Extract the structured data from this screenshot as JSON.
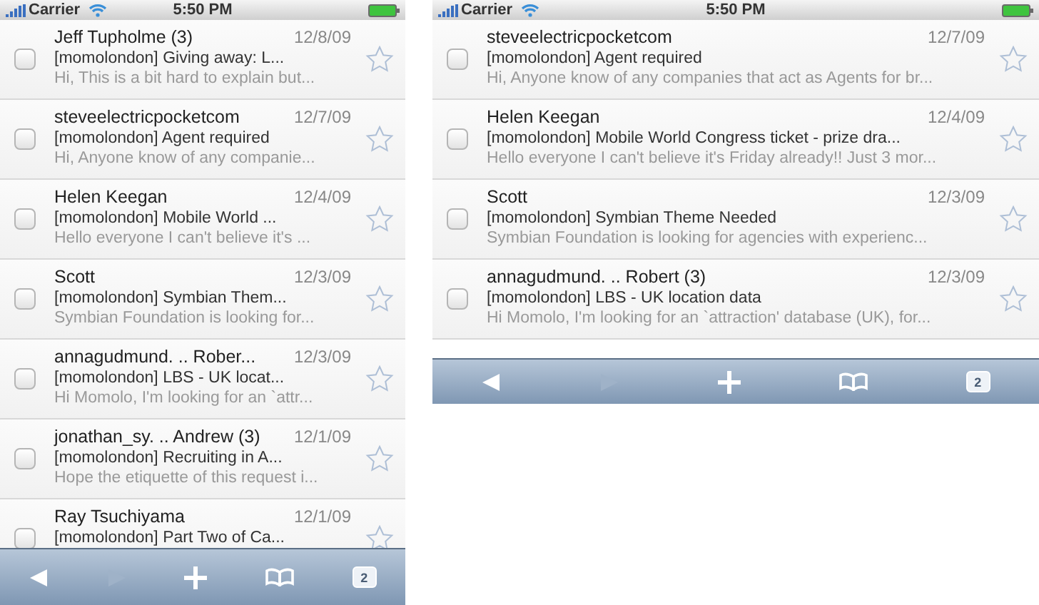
{
  "phones": [
    {
      "status": {
        "carrier": "Carrier",
        "time": "5:50 PM"
      },
      "kind": "portrait",
      "rows": [
        {
          "sender": "Jeff Tupholme (3)",
          "date": "12/8/09",
          "subject": "[momolondon] Giving away: L...",
          "snippet": "Hi, This is a bit hard to explain but...",
          "checked": false,
          "starred": false
        },
        {
          "sender": "steveelectricpocketcom",
          "date": "12/7/09",
          "subject": "[momolondon] Agent required",
          "snippet": "Hi, Anyone know of any companie...",
          "checked": false,
          "starred": false
        },
        {
          "sender": "Helen Keegan",
          "date": "12/4/09",
          "subject": "[momolondon] Mobile World ...",
          "snippet": "Hello everyone I can't believe it's ...",
          "checked": false,
          "starred": false
        },
        {
          "sender": "Scott",
          "date": "12/3/09",
          "subject": "[momolondon] Symbian Them...",
          "snippet": "Symbian Foundation is looking for...",
          "checked": false,
          "starred": false
        },
        {
          "sender": "annagudmund. .. Rober...",
          "date": "12/3/09",
          "subject": "[momolondon] LBS - UK locat...",
          "snippet": "Hi Momolo, I'm looking for an `attr...",
          "checked": false,
          "starred": false
        },
        {
          "sender": "jonathan_sy. .. Andrew (3)",
          "date": "12/1/09",
          "subject": "[momolondon] Recruiting in A...",
          "snippet": "Hope the etiquette of this request i...",
          "checked": false,
          "starred": false
        },
        {
          "sender": "Ray Tsuchiyama",
          "date": "12/1/09",
          "subject": "[momolondon] Part Two of Ca...",
          "checked": false,
          "starred": false
        }
      ],
      "toolbar": {
        "tabs_count": "2"
      }
    },
    {
      "status": {
        "carrier": "Carrier",
        "time": "5:50 PM"
      },
      "kind": "landscape",
      "rows": [
        {
          "sender": "steveelectricpocketcom",
          "date": "12/7/09",
          "subject": "[momolondon] Agent required",
          "snippet": "Hi, Anyone know of any companies that act as Agents for br...",
          "checked": false,
          "starred": false
        },
        {
          "sender": "Helen Keegan",
          "date": "12/4/09",
          "subject": "[momolondon] Mobile World Congress ticket - prize dra...",
          "snippet": "Hello everyone I can't believe it's Friday already!! Just 3 mor...",
          "checked": false,
          "starred": false
        },
        {
          "sender": "Scott",
          "date": "12/3/09",
          "subject": "[momolondon] Symbian Theme Needed",
          "snippet": "Symbian Foundation is looking for agencies with experienc...",
          "checked": false,
          "starred": false
        },
        {
          "sender": "annagudmund. .. Robert (3)",
          "date": "12/3/09",
          "subject": "[momolondon] LBS - UK location data",
          "snippet": "Hi Momolo, I'm looking for an `attraction' database (UK), for...",
          "checked": false,
          "starred": false
        }
      ],
      "toolbar": {
        "tabs_count": "2"
      }
    }
  ]
}
